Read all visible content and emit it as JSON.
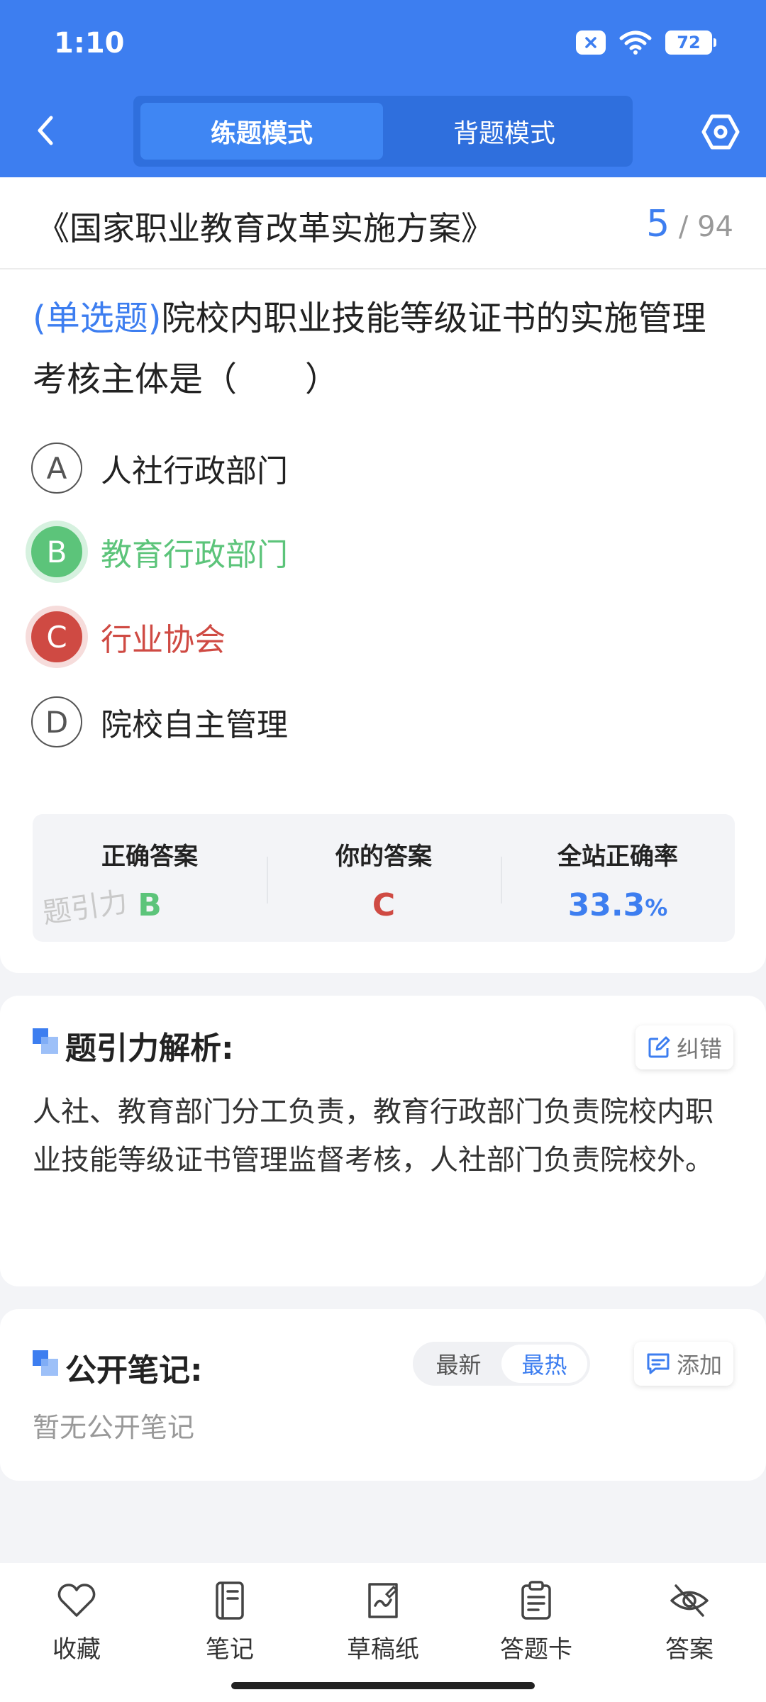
{
  "status_bar": {
    "time": "1:10",
    "battery": "72"
  },
  "header": {
    "modes": [
      {
        "label": "练题模式",
        "active": true
      },
      {
        "label": "背题模式",
        "active": false
      }
    ]
  },
  "title_bar": {
    "title": "《国家职业教育改革实施方案》",
    "current": "5",
    "total": "/ 94"
  },
  "question": {
    "type": "(单选题)",
    "text": "院校内职业技能等级证书的实施管理考核主体是（　　）",
    "options": [
      {
        "letter": "A",
        "text": "人社行政部门",
        "state": "normal"
      },
      {
        "letter": "B",
        "text": "教育行政部门",
        "state": "correct"
      },
      {
        "letter": "C",
        "text": "行业协会",
        "state": "wrong"
      },
      {
        "letter": "D",
        "text": "院校自主管理",
        "state": "normal"
      }
    ]
  },
  "answer_panel": {
    "correct_label": "正确答案",
    "correct_value": "B",
    "yours_label": "你的答案",
    "yours_value": "C",
    "rate_label": "全站正确率",
    "rate_value": "33.3",
    "rate_unit": "%",
    "watermark": "题引力"
  },
  "analysis": {
    "title": "题引力解析:",
    "report_label": "纠错",
    "text": "人社、教育部门分工负责，教育行政部门负责院校内职业技能等级证书管理监督考核，人社部门负责院校外。"
  },
  "notes": {
    "title": "公开笔记:",
    "sort_options": [
      "最新",
      "最热"
    ],
    "sort_active": "最热",
    "add_label": "添加",
    "empty_text": "暂无公开笔记"
  },
  "bottom_bar": {
    "items": [
      {
        "label": "收藏",
        "icon": "heart-icon"
      },
      {
        "label": "笔记",
        "icon": "notebook-icon"
      },
      {
        "label": "草稿纸",
        "icon": "draft-paper-icon"
      },
      {
        "label": "答题卡",
        "icon": "answer-card-icon"
      },
      {
        "label": "答案",
        "icon": "eye-off-icon"
      }
    ]
  },
  "colors": {
    "primary": "#3d7ef0",
    "correct": "#5cc47a",
    "wrong": "#cf4a43"
  }
}
